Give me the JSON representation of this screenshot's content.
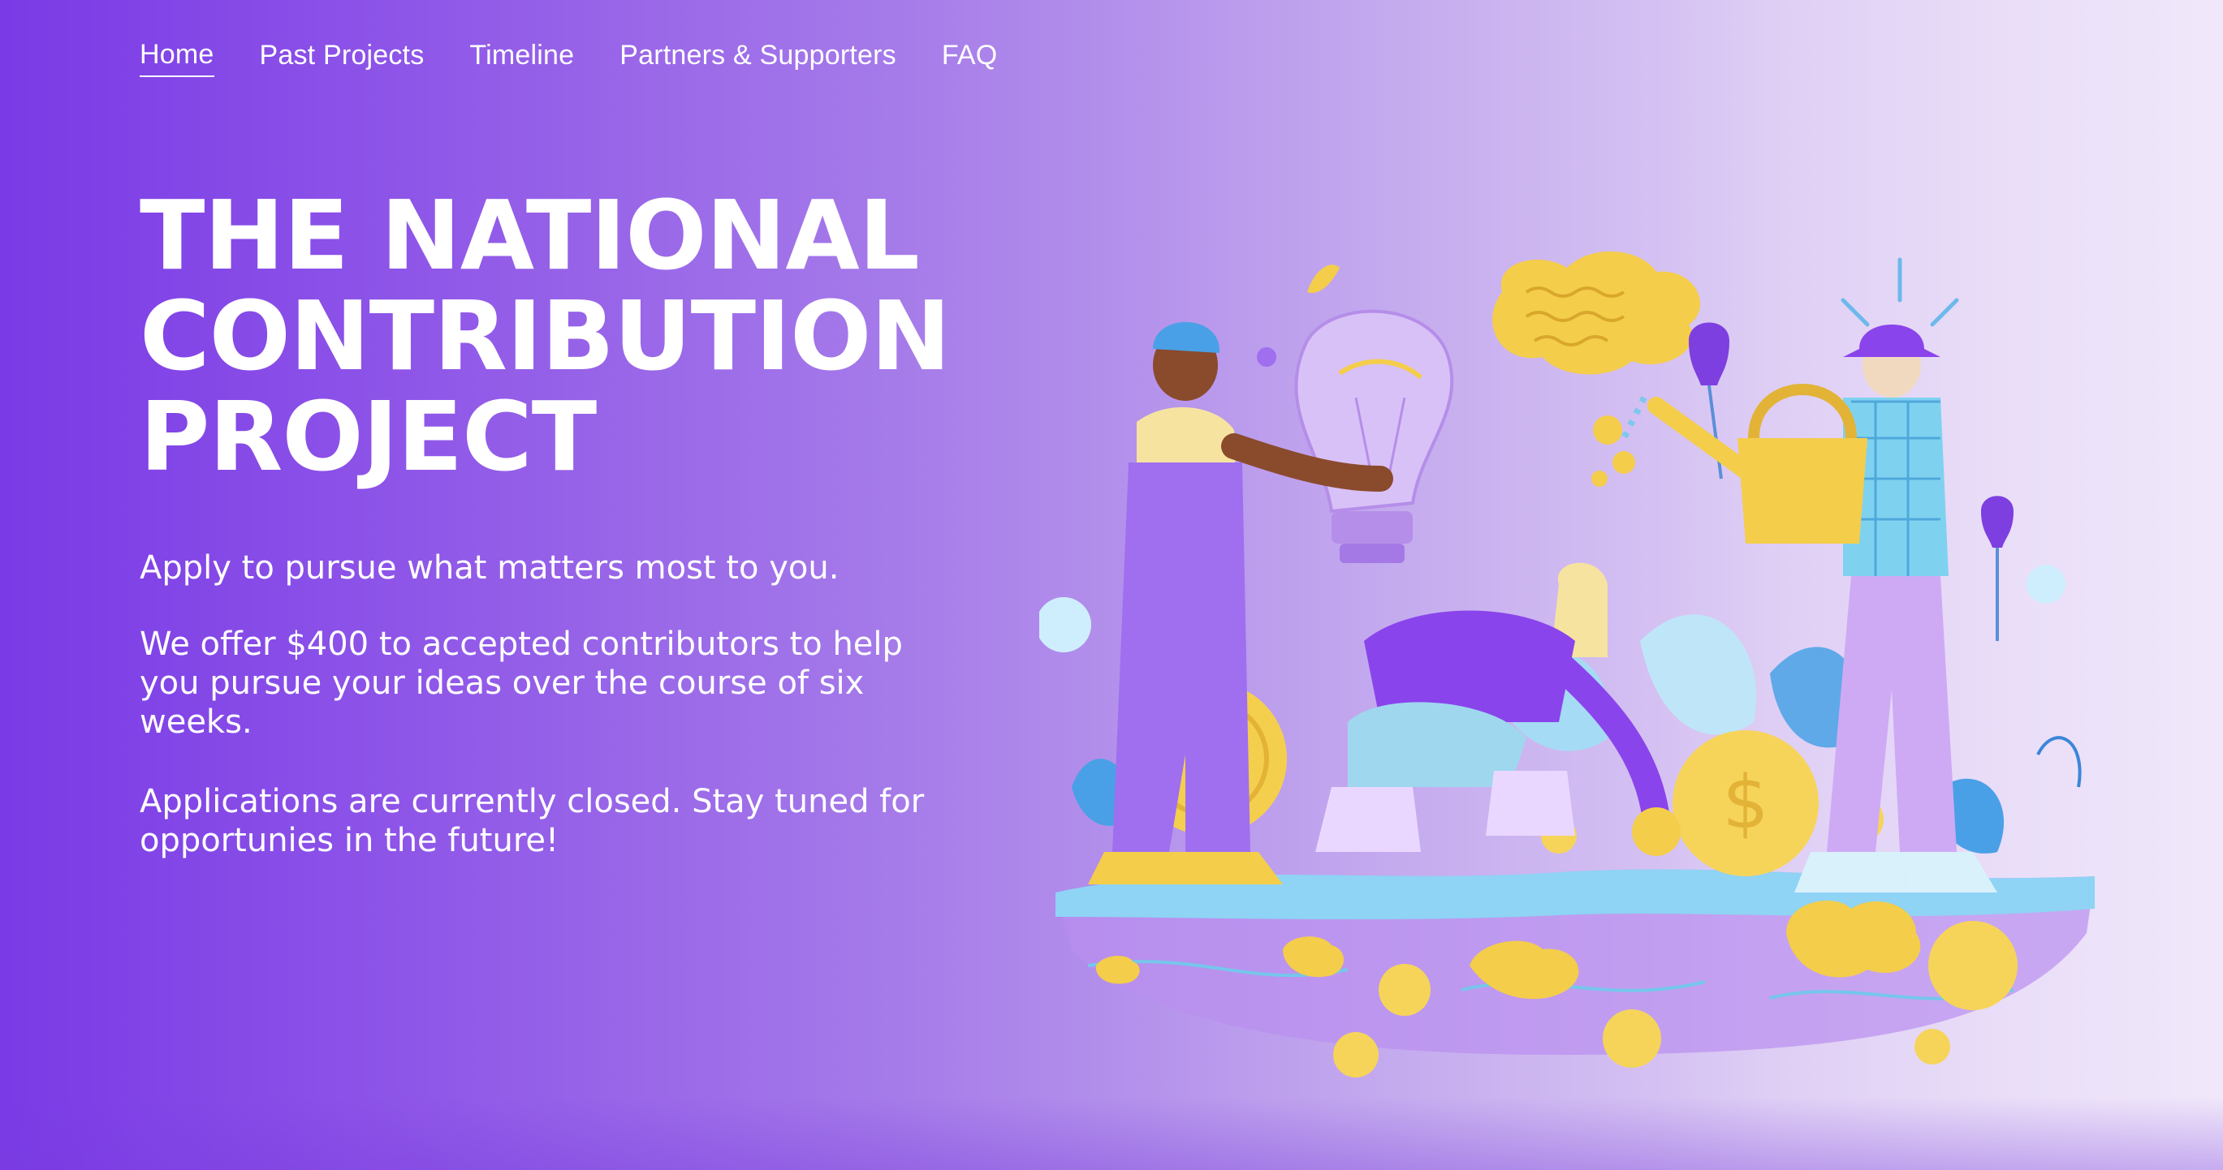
{
  "nav": {
    "items": [
      {
        "label": "Home",
        "active": true
      },
      {
        "label": "Past Projects",
        "active": false
      },
      {
        "label": "Timeline",
        "active": false
      },
      {
        "label": "Partners & Supporters",
        "active": false
      },
      {
        "label": "FAQ",
        "active": false
      }
    ]
  },
  "hero": {
    "title_lines": [
      "THE NATIONAL",
      "CONTRIBUTION",
      "PROJECT"
    ],
    "paragraphs": [
      "Apply to pursue what matters most to you.",
      "We offer $400 to accepted contributors to help you pursue your ideas over the course of six weeks.",
      "Applications are currently closed.  Stay tuned for opportunies in the future!"
    ]
  },
  "colors": {
    "primary": "#7a3ae6",
    "accent_gold": "#f3cd4a",
    "accent_blue": "#7ec8ee",
    "accent_lilac": "#c79cf2",
    "text": "#ffffff"
  }
}
